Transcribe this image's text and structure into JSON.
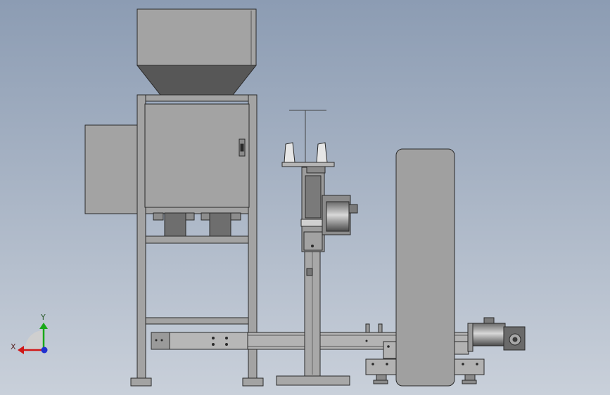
{
  "triad": {
    "x_label": "X",
    "y_label": "Y",
    "x_color": "#d01818",
    "y_color": "#18a818",
    "z_color": "#2030d0"
  },
  "palette": {
    "body_fill": "#a3a3a3",
    "body_stroke": "#2a2a2a",
    "dark_fill": "#5a5a5a",
    "light_fill": "#b9b9b9"
  }
}
